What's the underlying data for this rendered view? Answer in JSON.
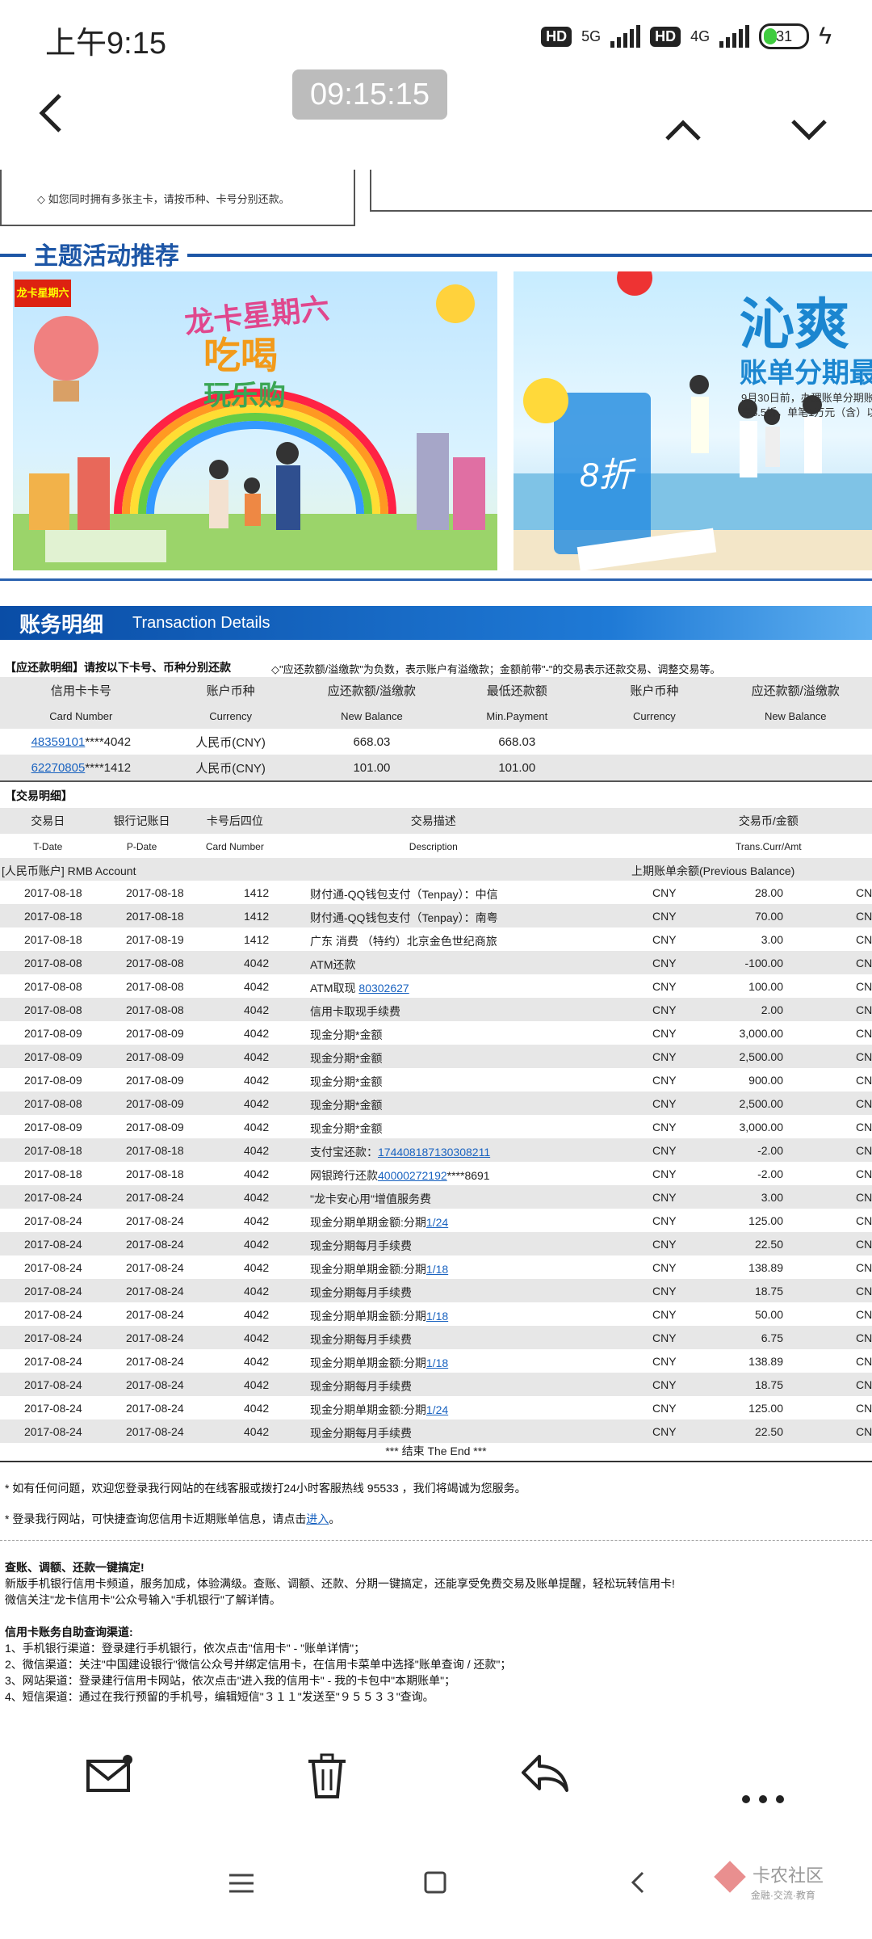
{
  "status": {
    "time": "上午9:15",
    "hd1": "HD",
    "net1": "5G",
    "hd2": "HD",
    "net2": "4G",
    "battery": "31"
  },
  "nav": {
    "timestamp": "09:15:15"
  },
  "top_notice": "◇ 如您同时拥有多张主卡，请按币种、卡号分别还款。",
  "section_title": "主题活动推荐",
  "banner1": {
    "logo": "龙卡星期六",
    "title1": "龙卡星期六",
    "title2": "吃喝",
    "title3": "玩乐购"
  },
  "banner2": {
    "title": "沁爽",
    "subtitle": "账单分期最",
    "note1": "9月30日前，办理账单分期账",
    "note2": "享8.5折，单笔1万元（含）以",
    "glass": "8折"
  },
  "txn_header": {
    "cn": "账务明细",
    "en": "Transaction Details"
  },
  "due_section": {
    "title": "【应还款明细】请按以下卡号、币种分别还款",
    "note": "◇\"应还款额/溢缴款\"为负数，表示账户有溢缴款；金额前带\"-\"的交易表示还款交易、调整交易等。",
    "headers_cn": [
      "信用卡卡号",
      "账户币种",
      "应还款额/溢缴款",
      "最低还款额",
      "账户币种",
      "应还款额/溢缴款"
    ],
    "headers_en": [
      "Card Number",
      "Currency",
      "New Balance",
      "Min.Payment",
      "Currency",
      "New Balance"
    ],
    "rows": [
      {
        "card_link": "48359101",
        "card_rest": "****4042",
        "currency": "人民币(CNY)",
        "balance": "668.03",
        "min": "668.03"
      },
      {
        "card_link": "62270805",
        "card_rest": "****1412",
        "currency": "人民币(CNY)",
        "balance": "101.00",
        "min": "101.00"
      }
    ]
  },
  "txn_section": {
    "title": "【交易明细】",
    "headers_cn": [
      "交易日",
      "银行记账日",
      "卡号后四位",
      "交易描述",
      "交易币/金额"
    ],
    "headers_en": [
      "T-Date",
      "P-Date",
      "Card Number",
      "Description",
      "Trans.Curr/Amt"
    ],
    "account_label": "[人民币账户] RMB Account",
    "prev_balance": "上期账单余额(Previous Balance)",
    "rows": [
      {
        "t": "2017-08-18",
        "p": "2017-08-18",
        "c": "1412",
        "d": "财付通-QQ钱包支付（Tenpay）：中信",
        "cur": "CNY",
        "amt": "28.00",
        "cur2": "CN"
      },
      {
        "t": "2017-08-18",
        "p": "2017-08-18",
        "c": "1412",
        "d": "财付通-QQ钱包支付（Tenpay）：南粤",
        "cur": "CNY",
        "amt": "70.00",
        "cur2": "CN"
      },
      {
        "t": "2017-08-18",
        "p": "2017-08-19",
        "c": "1412",
        "d": "广东 消费 （特约）北京金色世纪商旅",
        "cur": "CNY",
        "amt": "3.00",
        "cur2": "CN"
      },
      {
        "t": "2017-08-08",
        "p": "2017-08-08",
        "c": "4042",
        "d": "ATM还款",
        "cur": "CNY",
        "amt": "-100.00",
        "cur2": "CN"
      },
      {
        "t": "2017-08-08",
        "p": "2017-08-08",
        "c": "4042",
        "d": "ATM取现 ",
        "link": "80302627",
        "cur": "CNY",
        "amt": "100.00",
        "cur2": "CN"
      },
      {
        "t": "2017-08-08",
        "p": "2017-08-08",
        "c": "4042",
        "d": "信用卡取现手续费",
        "cur": "CNY",
        "amt": "2.00",
        "cur2": "CN"
      },
      {
        "t": "2017-08-09",
        "p": "2017-08-09",
        "c": "4042",
        "d": "现金分期*金额",
        "cur": "CNY",
        "amt": "3,000.00",
        "cur2": "CN"
      },
      {
        "t": "2017-08-09",
        "p": "2017-08-09",
        "c": "4042",
        "d": "现金分期*金额",
        "cur": "CNY",
        "amt": "2,500.00",
        "cur2": "CN"
      },
      {
        "t": "2017-08-09",
        "p": "2017-08-09",
        "c": "4042",
        "d": "现金分期*金额",
        "cur": "CNY",
        "amt": "900.00",
        "cur2": "CN"
      },
      {
        "t": "2017-08-08",
        "p": "2017-08-09",
        "c": "4042",
        "d": "现金分期*金额",
        "cur": "CNY",
        "amt": "2,500.00",
        "cur2": "CN"
      },
      {
        "t": "2017-08-09",
        "p": "2017-08-09",
        "c": "4042",
        "d": "现金分期*金额",
        "cur": "CNY",
        "amt": "3,000.00",
        "cur2": "CN"
      },
      {
        "t": "2017-08-18",
        "p": "2017-08-18",
        "c": "4042",
        "d": "支付宝还款：",
        "link": "174408187130308211",
        "cur": "CNY",
        "amt": "-2.00",
        "cur2": "CN"
      },
      {
        "t": "2017-08-18",
        "p": "2017-08-18",
        "c": "4042",
        "d": "网银跨行还款",
        "link": "40000272192",
        "d2": "****8691",
        "cur": "CNY",
        "amt": "-2.00",
        "cur2": "CN"
      },
      {
        "t": "2017-08-24",
        "p": "2017-08-24",
        "c": "4042",
        "d": "\"龙卡安心用\"增值服务费",
        "cur": "CNY",
        "amt": "3.00",
        "cur2": "CN"
      },
      {
        "t": "2017-08-24",
        "p": "2017-08-24",
        "c": "4042",
        "d": "现金分期单期金额:分期",
        "link": "1/24",
        "cur": "CNY",
        "amt": "125.00",
        "cur2": "CN"
      },
      {
        "t": "2017-08-24",
        "p": "2017-08-24",
        "c": "4042",
        "d": "现金分期每月手续费",
        "cur": "CNY",
        "amt": "22.50",
        "cur2": "CN"
      },
      {
        "t": "2017-08-24",
        "p": "2017-08-24",
        "c": "4042",
        "d": "现金分期单期金额:分期",
        "link": "1/18",
        "cur": "CNY",
        "amt": "138.89",
        "cur2": "CN"
      },
      {
        "t": "2017-08-24",
        "p": "2017-08-24",
        "c": "4042",
        "d": "现金分期每月手续费",
        "cur": "CNY",
        "amt": "18.75",
        "cur2": "CN"
      },
      {
        "t": "2017-08-24",
        "p": "2017-08-24",
        "c": "4042",
        "d": "现金分期单期金额:分期",
        "link": "1/18",
        "cur": "CNY",
        "amt": "50.00",
        "cur2": "CN"
      },
      {
        "t": "2017-08-24",
        "p": "2017-08-24",
        "c": "4042",
        "d": "现金分期每月手续费",
        "cur": "CNY",
        "amt": "6.75",
        "cur2": "CN"
      },
      {
        "t": "2017-08-24",
        "p": "2017-08-24",
        "c": "4042",
        "d": "现金分期单期金额:分期",
        "link": "1/18",
        "cur": "CNY",
        "amt": "138.89",
        "cur2": "CN"
      },
      {
        "t": "2017-08-24",
        "p": "2017-08-24",
        "c": "4042",
        "d": "现金分期每月手续费",
        "cur": "CNY",
        "amt": "18.75",
        "cur2": "CN"
      },
      {
        "t": "2017-08-24",
        "p": "2017-08-24",
        "c": "4042",
        "d": "现金分期单期金额:分期",
        "link": "1/24",
        "cur": "CNY",
        "amt": "125.00",
        "cur2": "CN"
      },
      {
        "t": "2017-08-24",
        "p": "2017-08-24",
        "c": "4042",
        "d": "现金分期每月手续费",
        "cur": "CNY",
        "amt": "22.50",
        "cur2": "CN"
      }
    ],
    "end": "*** 结束 The End ***"
  },
  "footer": {
    "p1": "* 如有任何问题，欢迎您登录我行网站的在线客服或拨打24小时客服热线 95533 ，我们将竭诚为您服务。",
    "p2_a": "* 登录我行网站，可快捷查询您信用卡近期账单信息，请点击",
    "p2_link": "进入",
    "p2_b": "。",
    "promo_title": "查账、调额、还款一键搞定!",
    "promo_1": "新版手机银行信用卡频道，服务加成，体验满级。查账、调额、还款、分期一键搞定，还能享受免费交易及账单提醒，轻松玩转信用卡!",
    "promo_2": "微信关注\"龙卡信用卡\"公众号输入\"手机银行\"了解详情。",
    "channels_title": "信用卡账务自助查询渠道:",
    "channels": [
      "1、手机银行渠道：登录建行手机银行，依次点击\"信用卡\" - \"账单详情\"；",
      "2、微信渠道：关注\"中国建设银行\"微信公众号并绑定信用卡，在信用卡菜单中选择\"账单查询 / 还款\"；",
      "3、网站渠道：登录建行信用卡网站，依次点击\"进入我的信用卡\" - 我的卡包中\"本期账单\"；",
      "4、短信渠道：通过在我行预留的手机号，编辑短信\"３１１\"发送至\"９５５３３\"查询。"
    ]
  },
  "watermark": {
    "line1": "卡农社区",
    "line2": "金融·交流·教育"
  }
}
